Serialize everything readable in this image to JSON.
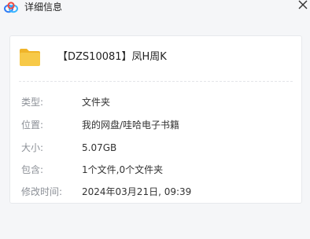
{
  "window": {
    "title": "详细信息",
    "app_icon": "cloud-logo-icon",
    "close_icon": "close-icon"
  },
  "file": {
    "icon": "folder-icon",
    "name": "【DZS10081】凤H周K"
  },
  "details": [
    {
      "label": "类型:",
      "value": "文件夹"
    },
    {
      "label": "位置:",
      "value": "我的网盘/哇哈电子书籍"
    },
    {
      "label": "大小:",
      "value": "5.07GB"
    },
    {
      "label": "包含:",
      "value": "1个文件,0个文件夹"
    },
    {
      "label": "修改时间:",
      "value": "2024年03月21日, 09:39"
    }
  ],
  "colors": {
    "background": "#f5f6f8",
    "card": "#ffffff",
    "label": "#8c9097",
    "value": "#333333",
    "folder": "#f7c948"
  }
}
